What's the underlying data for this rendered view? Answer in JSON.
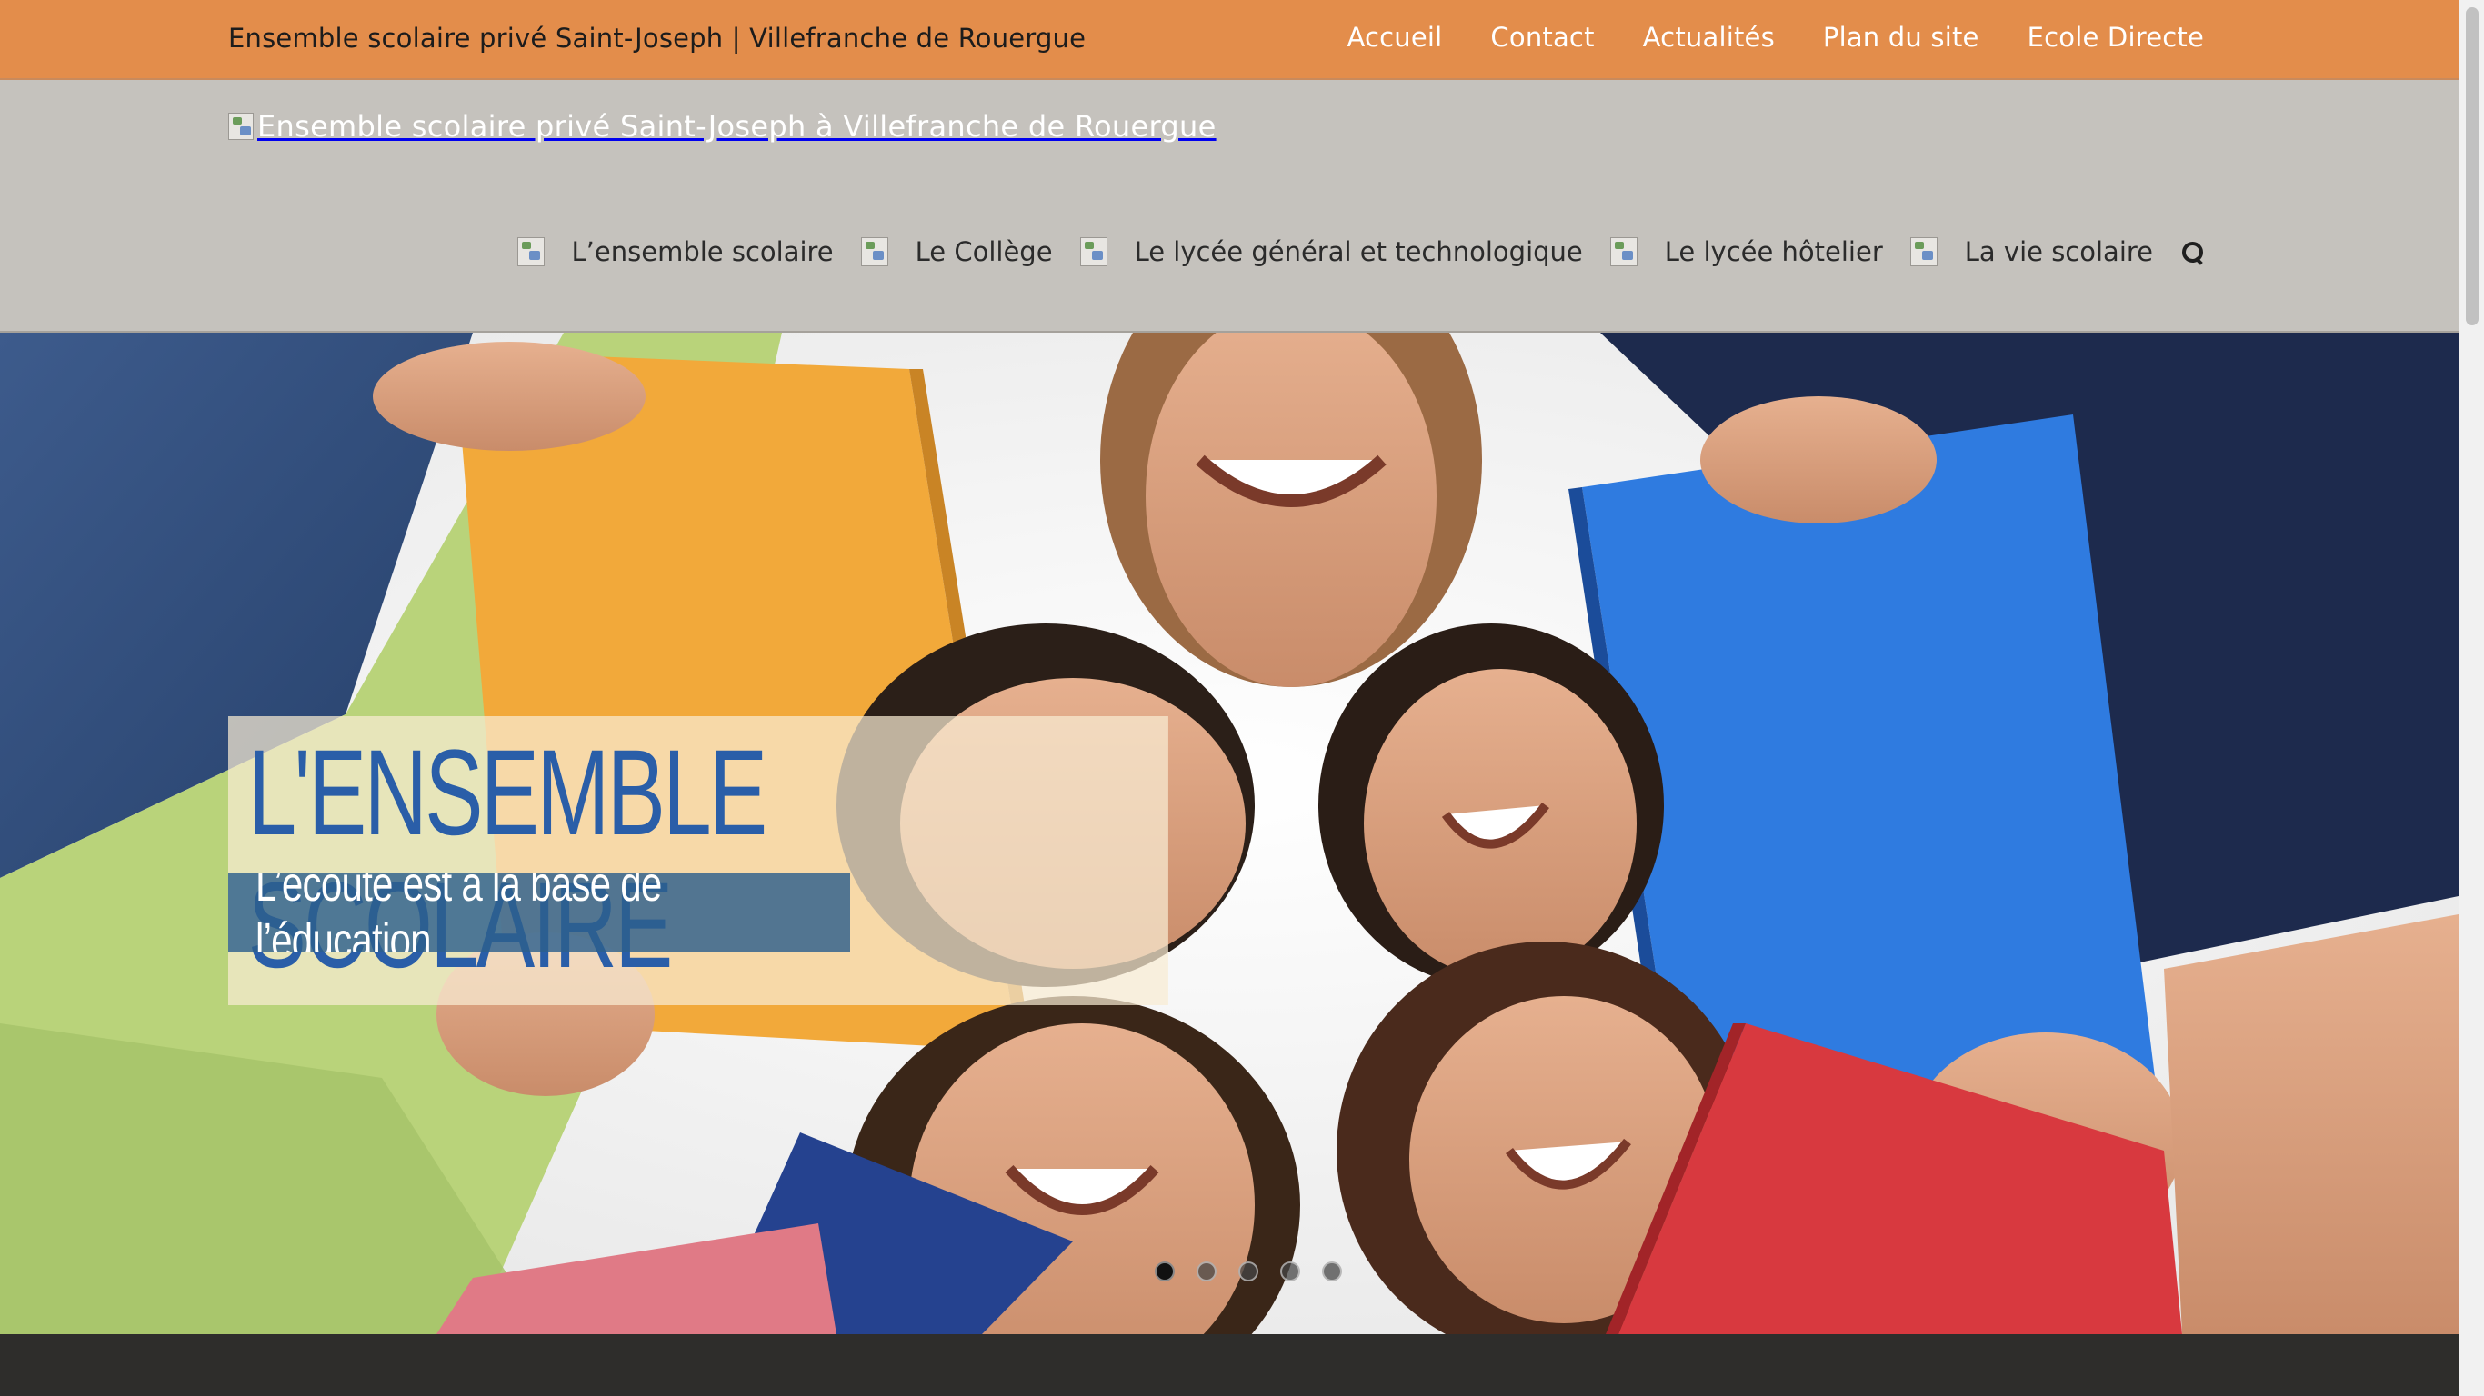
{
  "topbar": {
    "site_name": "Ensemble scolaire privé Saint-Joseph | Villefranche de Rouergue",
    "links": [
      "Accueil",
      "Contact",
      "Actualités",
      "Plan du site",
      "Ecole Directe"
    ]
  },
  "header": {
    "logo_alt": "Ensemble scolaire privé Saint-Joseph à Villefranche de Rouergue",
    "nav": [
      "L’ensemble scolaire",
      "Le Collège",
      "Le lycée général et technologique",
      "Le lycée hôtelier",
      "La vie scolaire"
    ],
    "search_icon": "search-icon"
  },
  "hero": {
    "title": "L'ENSEMBLE SCOLAIRE",
    "subtitle": "L’écoute est à la base de l’éducation",
    "slide_count": 5,
    "active_slide": 1
  },
  "colors": {
    "topbar": "#e38d4b",
    "header": "#c5c2bd",
    "title_text": "#2a5ea8",
    "subtitle_bg": "#2d5f8c",
    "footer": "#2e2d2b"
  }
}
